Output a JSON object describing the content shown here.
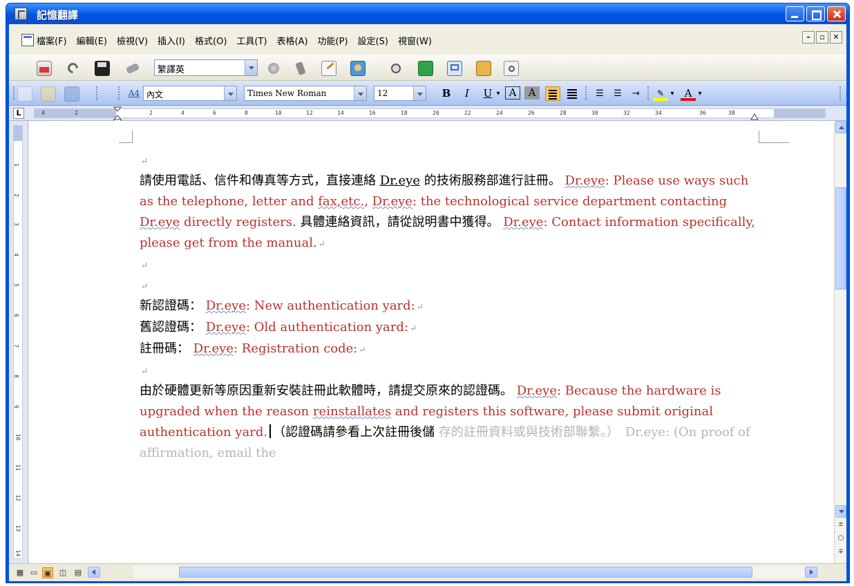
{
  "window": {
    "title": "記憶翻譯"
  },
  "menubar": {
    "items": [
      "檔案(F)",
      "編輯(E)",
      "檢視(V)",
      "插入(I)",
      "格式(O)",
      "工具(T)",
      "表格(A)",
      "功能(P)",
      "設定(S)",
      "視窗(W)"
    ],
    "mdi_min": "–",
    "mdi_restore": "▫",
    "mdi_close": "✕"
  },
  "toolbar": {
    "language_combo": "繁譯英"
  },
  "format_bar": {
    "style": "內文",
    "style_icon_label": "A4",
    "font": "Times New Roman",
    "size": "12",
    "bold": "B",
    "italic": "I",
    "underline": "U",
    "border_char": "A",
    "shade_char": "A",
    "font_color_char": "A"
  },
  "ruler": {
    "corner": "L",
    "ticks": [
      "4",
      "2",
      "2",
      "4",
      "6",
      "8",
      "10",
      "12",
      "14",
      "16",
      "18",
      "20",
      "22",
      "24",
      "26",
      "28",
      "30",
      "32",
      "34",
      "36",
      "38"
    ]
  },
  "vruler": {
    "ticks": [
      "1",
      "2",
      "3",
      "4",
      "5",
      "6",
      "7",
      "8",
      "9",
      "10",
      "11",
      "12",
      "13",
      "14"
    ]
  },
  "document": {
    "para_mark": "↵",
    "p1": {
      "zh1": "請使用電話、信件和傳真等方式，直接連絡 ",
      "brand": "Dr.eye",
      "zh2": " 的技術服務部進行註冊。",
      "tag1": "Dr.eye",
      "en1a": ": Please use ways such as the telephone, letter and ",
      "en1b": "fax,etc.",
      "en1c": ", ",
      "tag2": "Dr.eye",
      "en1d": ": the technological service department contacting ",
      "tag3": "Dr.eye",
      "en1e": " directly registers.",
      "zh3": "具體連絡資訊，請從說明書中獲得。",
      "tag4": "Dr.eye",
      "en2": ": Contact information specifically, please get from the manual."
    },
    "line_new": {
      "zh": "新認證碼：",
      "tag": "Dr.eye",
      "en": ": New authentication yard:"
    },
    "line_old": {
      "zh": "舊認證碼：",
      "tag": "Dr.eye",
      "en": ": Old authentication yard:"
    },
    "line_reg": {
      "zh": "註冊碼：",
      "tag": "Dr.eye",
      "en": ": Registration code:"
    },
    "p2": {
      "zh1": "由於硬體更新等原因重新安裝註冊此軟體時，請提交原來的認證碼。",
      "tag1": "Dr.eye",
      "en1a": ": Because the hardware is upgraded when the reason ",
      "en1b": "reinstallates",
      "en1c": " and registers this software, please submit original authentication yard.",
      "zh2": "（認證碼請參看上次註冊後儲",
      "tail": "存的註冊資料或與技術部聯繫。）　Dr.eye: (On proof of affirmation, email the"
    }
  },
  "statusbar": {
    "view_icons": [
      "▦",
      "▭",
      "▣",
      "◫",
      "▤"
    ],
    "browse": [
      "±",
      "○",
      "∓"
    ]
  },
  "colors": {
    "title_blue": "#0054e3",
    "translation_red": "#b7332f",
    "active_orange": "#ffc35a"
  }
}
